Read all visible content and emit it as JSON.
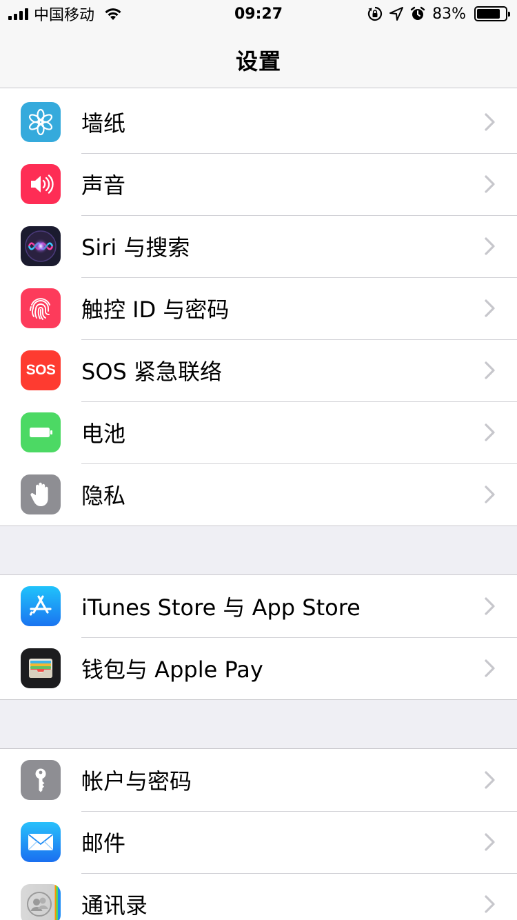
{
  "status_bar": {
    "carrier": "中国移动",
    "time": "09:27",
    "battery_percent": "83%",
    "battery_level": 0.83
  },
  "nav": {
    "title": "设置"
  },
  "groups": [
    {
      "items": [
        {
          "label": "墙纸",
          "icon": "wallpaper-flower-icon",
          "color": "#35aadc"
        },
        {
          "label": "声音",
          "icon": "speaker-icon",
          "color": "#fe2d55"
        },
        {
          "label": "Siri 与搜索",
          "icon": "siri-icon",
          "color": "#1b1b2f"
        },
        {
          "label": "触控 ID 与密码",
          "icon": "fingerprint-icon",
          "color": "#fd3b5b"
        },
        {
          "label": "SOS 紧急联络",
          "icon": "sos-icon",
          "icon_text": "SOS",
          "color": "#fe3b30"
        },
        {
          "label": "电池",
          "icon": "battery-icon",
          "color": "#4cd964"
        },
        {
          "label": "隐私",
          "icon": "hand-icon",
          "color": "#8e8e93"
        }
      ]
    },
    {
      "items": [
        {
          "label": "iTunes Store 与 App Store",
          "icon": "app-store-icon",
          "color": "#1b8bf5"
        },
        {
          "label": "钱包与 Apple Pay",
          "icon": "wallet-icon",
          "color": "#1c1c1e"
        }
      ]
    },
    {
      "items": [
        {
          "label": "帐户与密码",
          "icon": "key-icon",
          "color": "#8e8e93"
        },
        {
          "label": "邮件",
          "icon": "mail-envelope-icon",
          "color": "#1e8cf5"
        },
        {
          "label": "通讯录",
          "icon": "contacts-icon",
          "color": "#c7c7c7"
        }
      ]
    }
  ]
}
